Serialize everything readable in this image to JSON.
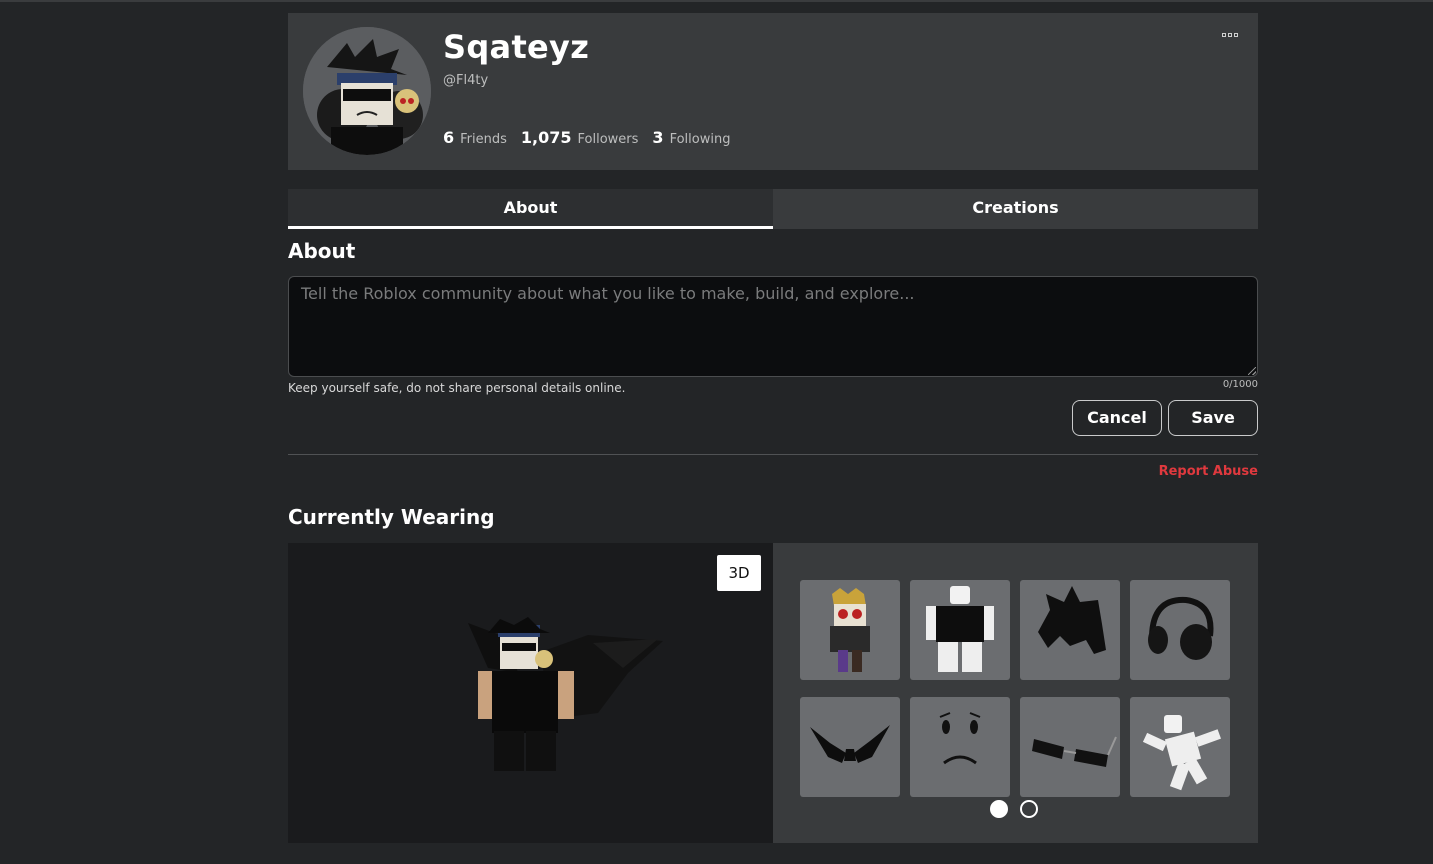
{
  "profile": {
    "display_name": "Sqateyz",
    "username": "@Fl4ty",
    "stats": [
      {
        "num": "6",
        "label": "Friends"
      },
      {
        "num": "1,075",
        "label": "Followers"
      },
      {
        "num": "3",
        "label": "Following"
      }
    ]
  },
  "tabs": [
    {
      "label": "About",
      "active": true
    },
    {
      "label": "Creations",
      "active": false
    }
  ],
  "about": {
    "title": "About",
    "placeholder": "Tell the Roblox community about what you like to make, build, and explore...",
    "value": "",
    "safety_note": "Keep yourself safe, do not share personal details online.",
    "counter": "0/1000",
    "cancel_label": "Cancel",
    "save_label": "Save",
    "report_label": "Report Abuse"
  },
  "wearing": {
    "title": "Currently Wearing",
    "toggle_3d_label": "3D",
    "items": [
      {
        "icon": "avatar-figure-icon"
      },
      {
        "icon": "shirt-torso-icon"
      },
      {
        "icon": "spiky-hair-icon"
      },
      {
        "icon": "headphones-icon"
      },
      {
        "icon": "black-wings-icon"
      },
      {
        "icon": "sad-face-icon"
      },
      {
        "icon": "sunglasses-icon"
      },
      {
        "icon": "dance-pose-icon"
      }
    ],
    "page_count": 2,
    "current_page": 1
  },
  "colors": {
    "background": "#232527",
    "panel": "#393b3d",
    "report": "#e0393e"
  }
}
